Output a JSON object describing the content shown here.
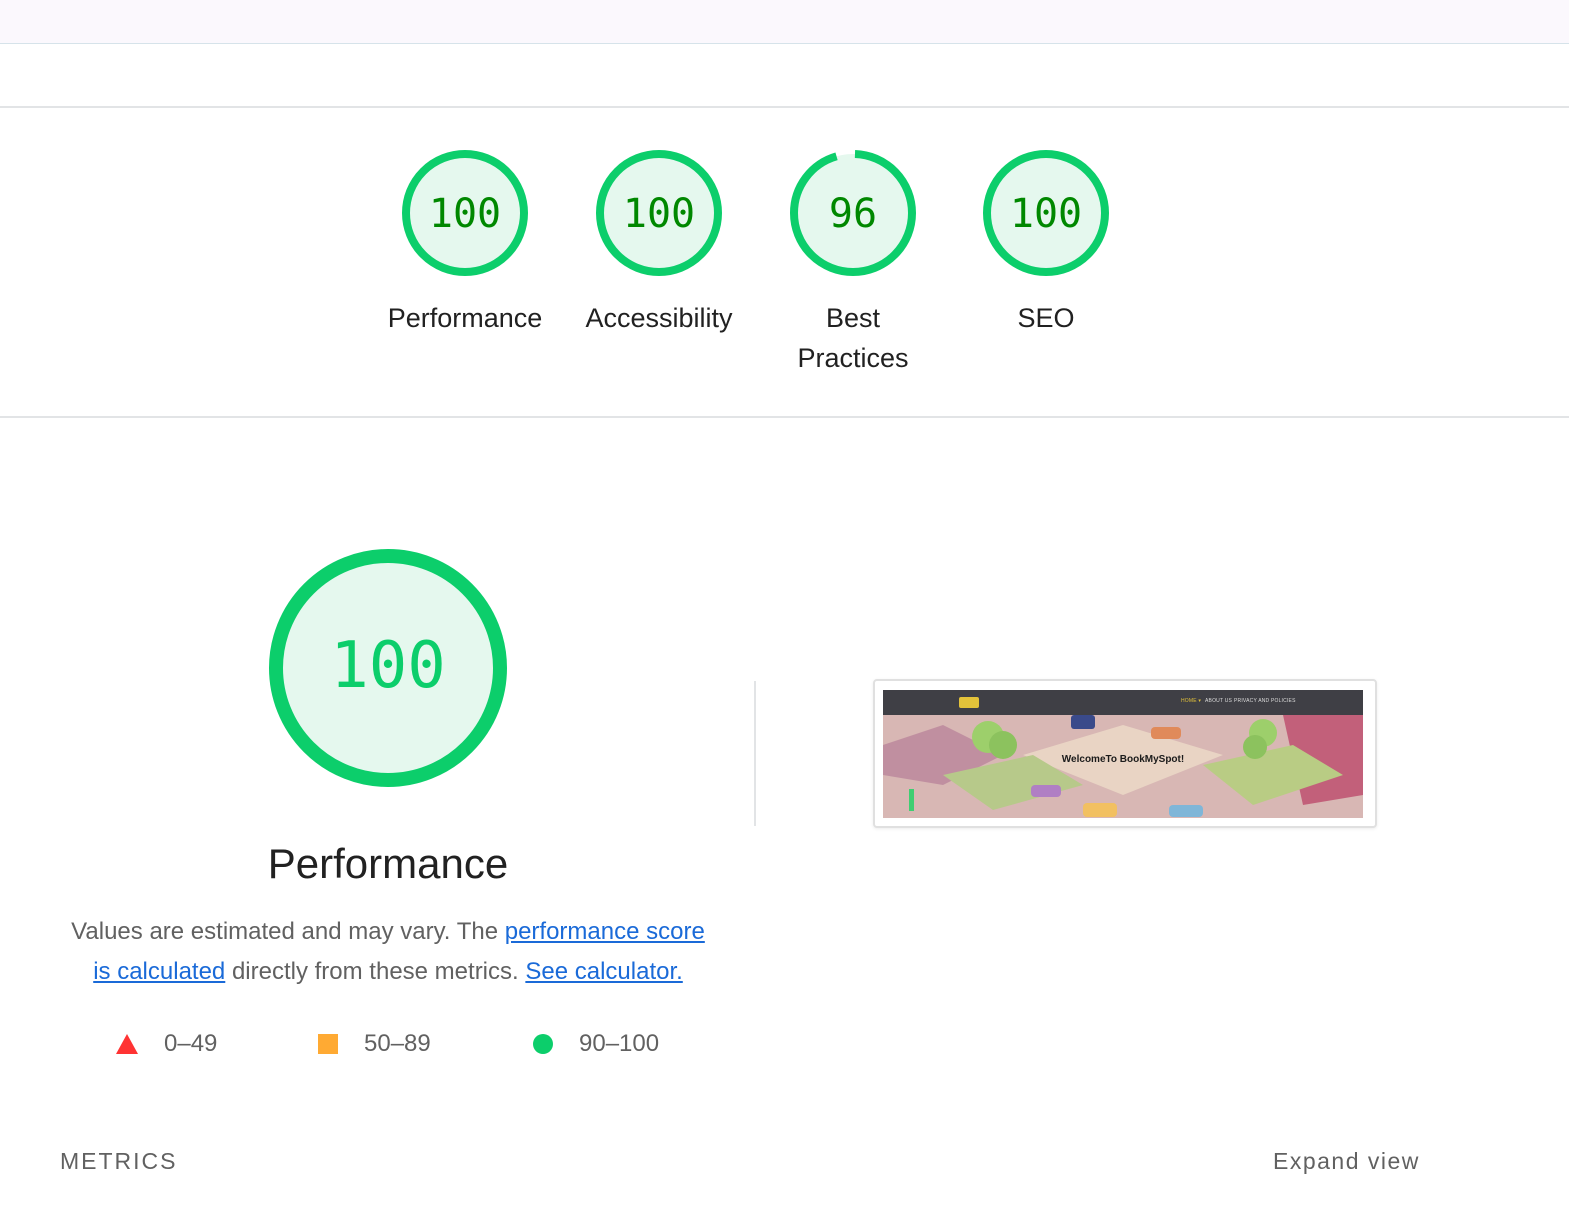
{
  "summary_gauges": [
    {
      "label": "Performance",
      "score": "100",
      "fraction": 1.0
    },
    {
      "label": "Accessibility",
      "score": "100",
      "fraction": 1.0
    },
    {
      "label": "Best Practices",
      "score": "96",
      "fraction": 0.96
    },
    {
      "label": "SEO",
      "score": "100",
      "fraction": 1.0
    }
  ],
  "performance": {
    "score": "100",
    "fraction": 1.0,
    "title": "Performance",
    "description_prefix": "Values are estimated and may vary. The ",
    "score_link": "performance score is calculated",
    "description_middle": " directly from these metrics. ",
    "calculator_link": "See calculator."
  },
  "legend": [
    {
      "shape": "triangle",
      "color": "#ff3333",
      "range": "0–49"
    },
    {
      "shape": "square",
      "color": "#ffaa33",
      "range": "50–89"
    },
    {
      "shape": "circle",
      "color": "#0cce6b",
      "range": "90–100"
    }
  ],
  "colors": {
    "pass": "#0cce6b",
    "pass_text": "#008800",
    "pass_fill": "#e5f8ee",
    "link": "#1a6ad8"
  },
  "screenshot": {
    "nav_items": [
      "HOME ▾",
      "ABOUT US",
      "PRIVACY AND POLICIES"
    ],
    "hero_text": "WelcomeTo BookMySpot!"
  },
  "metrics": {
    "label": "METRICS",
    "expand_label": "Expand view"
  }
}
